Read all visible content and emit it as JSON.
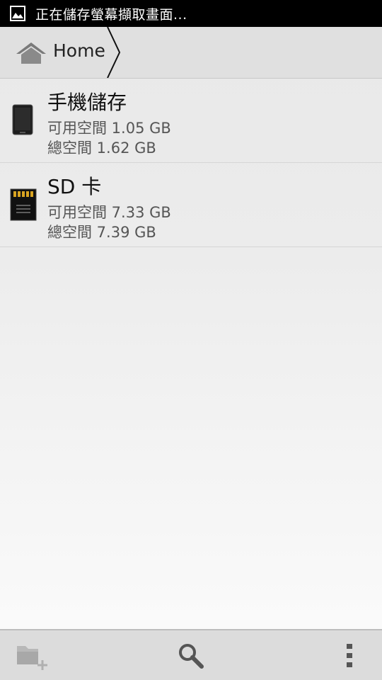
{
  "status_bar": {
    "notification_text": "正在儲存螢幕擷取畫面...",
    "icon": "image-icon"
  },
  "breadcrumb": {
    "items": [
      {
        "label": "Home",
        "icon": "home-icon"
      }
    ]
  },
  "storage": {
    "items": [
      {
        "name": "手機儲存",
        "free": "可用空間 1.05 GB",
        "total": "總空間 1.62 GB",
        "icon": "phone-icon"
      },
      {
        "name": "SD 卡",
        "free": "可用空間 7.33 GB",
        "total": "總空間 7.39 GB",
        "icon": "sd-card-icon"
      }
    ]
  },
  "bottom_bar": {
    "actions": [
      {
        "icon": "new-folder-icon",
        "enabled": false
      },
      {
        "icon": "search-icon",
        "enabled": true
      },
      {
        "icon": "overflow-menu-icon",
        "enabled": true
      }
    ]
  }
}
